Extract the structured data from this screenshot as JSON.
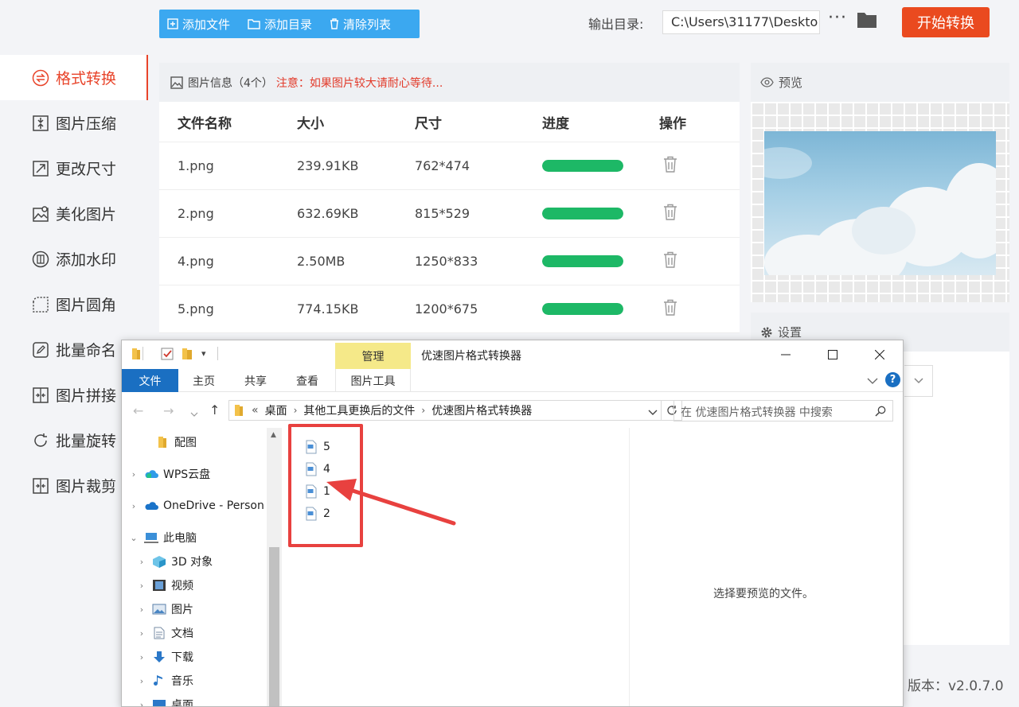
{
  "sidebar": {
    "items": [
      {
        "label": "格式转换",
        "icon": "convert-icon",
        "active": true
      },
      {
        "label": "图片压缩",
        "icon": "compress-icon"
      },
      {
        "label": "更改尺寸",
        "icon": "resize-icon"
      },
      {
        "label": "美化图片",
        "icon": "beautify-icon"
      },
      {
        "label": "添加水印",
        "icon": "watermark-icon"
      },
      {
        "label": "图片圆角",
        "icon": "rounded-corner-icon"
      },
      {
        "label": "批量命名",
        "icon": "rename-icon"
      },
      {
        "label": "图片拼接",
        "icon": "stitch-icon"
      },
      {
        "label": "批量旋转",
        "icon": "rotate-icon"
      },
      {
        "label": "图片裁剪",
        "icon": "crop-icon"
      }
    ]
  },
  "toolbar": {
    "add_file": "添加文件",
    "add_folder": "添加目录",
    "clear_list": "清除列表",
    "output_label": "输出目录:",
    "output_path": "C:\\Users\\31177\\Deskto",
    "more": "···",
    "start": "开始转换"
  },
  "info": {
    "title": "图片信息（4个）",
    "note": "注意：如果图片较大请耐心等待...",
    "columns": [
      "文件名称",
      "大小",
      "尺寸",
      "进度",
      "操作"
    ],
    "rows": [
      {
        "name": "1.png",
        "size": "239.91KB",
        "dim": "762*474",
        "progress": 1.0
      },
      {
        "name": "2.png",
        "size": "632.69KB",
        "dim": "815*529",
        "progress": 1.0
      },
      {
        "name": "4.png",
        "size": "2.50MB",
        "dim": "1250*833",
        "progress": 1.0
      },
      {
        "name": "5.png",
        "size": "774.15KB",
        "dim": "1200*675",
        "progress": 1.0
      }
    ]
  },
  "preview": {
    "title": "预览"
  },
  "settings": {
    "title": "设置"
  },
  "version": "版本：v2.0.7.0",
  "colors": {
    "accent": "#e8442a",
    "toolbar": "#3ba8f0",
    "progress": "#1db866",
    "start": "#ea4a1f"
  },
  "explorer": {
    "manage_tab": "管理",
    "title": "优速图片格式转换器",
    "ribbon_tabs": [
      "文件",
      "主页",
      "共享",
      "查看",
      "图片工具"
    ],
    "breadcrumb": [
      "«",
      "桌面",
      "其他工具更换后的文件",
      "优速图片格式转换器"
    ],
    "search_placeholder": "在 优速图片格式转换器 中搜索",
    "nav_items": [
      {
        "label": "配图",
        "icon": "folder-icon"
      },
      {
        "label": "WPS云盘",
        "icon": "cloud-icon"
      },
      {
        "label": "OneDrive - Person",
        "icon": "onedrive-icon"
      },
      {
        "label": "此电脑",
        "icon": "computer-icon"
      },
      {
        "label": "3D 对象",
        "icon": "3d-objects-icon"
      },
      {
        "label": "视频",
        "icon": "video-icon"
      },
      {
        "label": "图片",
        "icon": "pictures-icon"
      },
      {
        "label": "文档",
        "icon": "documents-icon"
      },
      {
        "label": "下载",
        "icon": "download-icon"
      },
      {
        "label": "音乐",
        "icon": "music-icon"
      },
      {
        "label": "桌面",
        "icon": "desktop-icon"
      }
    ],
    "files": [
      "5",
      "4",
      "1",
      "2"
    ],
    "preview_message": "选择要预览的文件。"
  }
}
